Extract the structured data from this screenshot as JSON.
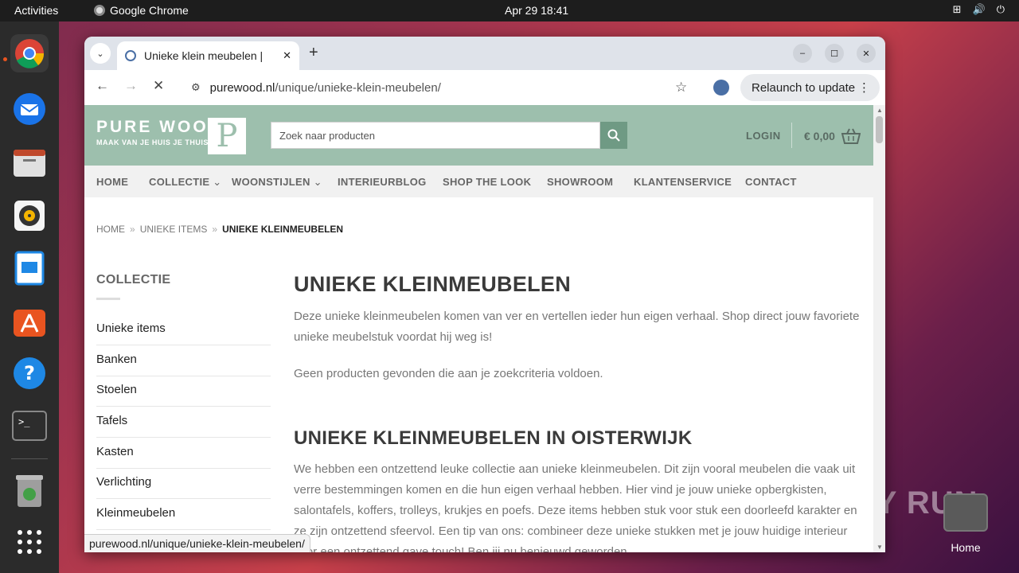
{
  "system": {
    "activities": "Activities",
    "app_name": "Google Chrome",
    "clock": "Apr 29  18:41",
    "desktop_home_label": "Home",
    "watermark": "ANY RUN"
  },
  "browser": {
    "tab_title": "Unieke klein meubelen |",
    "url_domain": "purewood.nl",
    "url_path": "/unique/unieke-klein-meubelen/",
    "relaunch_label": "Relaunch to update",
    "status_url": "purewood.nl/unique/unieke-klein-meubelen/"
  },
  "site": {
    "logo_big": "PURE WOOD",
    "logo_small": "MAAK VAN JE HUIS JE THUIS",
    "logo_mark": "P",
    "search_placeholder": "Zoek naar producten",
    "login": "LOGIN",
    "cart_total": "€ 0,00",
    "nav": [
      "HOME",
      "COLLECTIE",
      "WOONSTIJLEN",
      "INTERIEURBLOG",
      "SHOP THE LOOK",
      "SHOWROOM",
      "KLANTENSERVICE",
      "CONTACT"
    ],
    "breadcrumb": [
      "HOME",
      "UNIEKE ITEMS",
      "UNIEKE KLEINMEUBELEN"
    ],
    "sidebar_title": "COLLECTIE",
    "sidebar_items": [
      "Unieke items",
      "Banken",
      "Stoelen",
      "Tafels",
      "Kasten",
      "Verlichting",
      "Kleinmeubelen"
    ],
    "heading1": "UNIEKE KLEINMEUBELEN",
    "intro": "Deze unieke kleinmeubelen komen van ver en vertellen ieder hun eigen verhaal. Shop direct jouw favoriete unieke meubelstuk voordat hij weg is!",
    "no_products": "Geen producten gevonden die aan je zoekcriteria voldoen.",
    "heading2": "UNIEKE KLEINMEUBELEN IN OISTERWIJK",
    "body": "We hebben een ontzettend leuke collectie aan unieke kleinmeubelen. Dit zijn vooral meubelen die vaak uit verre bestemmingen komen en die hun eigen verhaal hebben. Hier vind je jouw unieke opbergkisten, salontafels, koffers, trolleys, krukjes en poefs. Deze items hebben stuk voor stuk een doorleefd karakter en ze zijn ontzettend sfeervol. Een tip van ons: combineer deze unieke stukken met je jouw huidige interieur voor een ontzettend gave touch! Ben jij nu benieuwd geworden"
  }
}
